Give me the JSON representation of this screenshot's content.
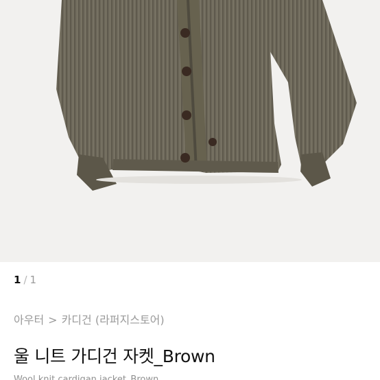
{
  "pager": {
    "current": "1",
    "separator": "/",
    "total": "1"
  },
  "breadcrumb": {
    "category": "아우터",
    "separator": ">",
    "subcategory": "카디건",
    "store": "(라퍼지스토어)"
  },
  "product": {
    "title": "울 니트 가디건 자켓_Brown",
    "subtitle": "Wool knit cardigan jacket_Brown"
  },
  "colors": {
    "image_background": "#f2f1ef",
    "knit": "#6f6a5c",
    "buttons": "#3a2a22"
  }
}
